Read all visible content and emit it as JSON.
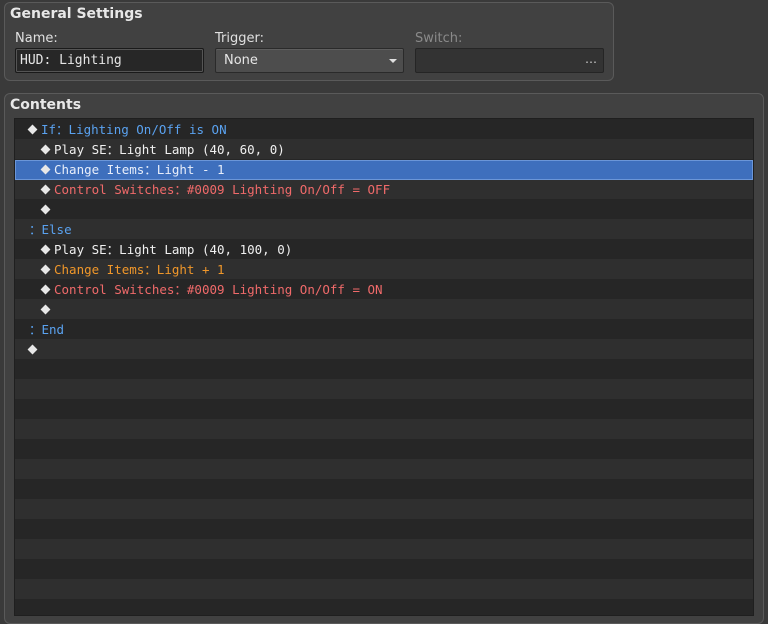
{
  "general": {
    "title": "General Settings",
    "name_label": "Name:",
    "name_value": "HUD: Lighting",
    "trigger_label": "Trigger:",
    "trigger_value": "None",
    "switch_label": "Switch:",
    "switch_button": "…"
  },
  "contents": {
    "title": "Contents",
    "rows": [
      {
        "indent": 0,
        "diamond": true,
        "text": "If：Lighting On/Off is ON",
        "color": "#5aa2f0"
      },
      {
        "indent": 1,
        "diamond": true,
        "text": "Play SE：Light Lamp (40, 60, 0)",
        "color": "#f0f0f0"
      },
      {
        "indent": 1,
        "diamond": true,
        "text": "Change Items：Light - 1",
        "color": "#f0972a",
        "selected": true
      },
      {
        "indent": 1,
        "diamond": true,
        "text": "Control Switches：#0009 Lighting On/Off = OFF",
        "color": "#f06a6a"
      },
      {
        "indent": 1,
        "diamond": true,
        "text": "",
        "color": "#f0f0f0"
      },
      {
        "indent": 0,
        "diamond": false,
        "text": "：Else",
        "color": "#5aa2f0"
      },
      {
        "indent": 1,
        "diamond": true,
        "text": "Play SE：Light Lamp (40, 100, 0)",
        "color": "#f0f0f0"
      },
      {
        "indent": 1,
        "diamond": true,
        "text": "Change Items：Light + 1",
        "color": "#f0972a"
      },
      {
        "indent": 1,
        "diamond": true,
        "text": "Control Switches：#0009 Lighting On/Off = ON",
        "color": "#f06a6a"
      },
      {
        "indent": 1,
        "diamond": true,
        "text": "",
        "color": "#f0f0f0"
      },
      {
        "indent": 0,
        "diamond": false,
        "text": "：End",
        "color": "#5aa2f0"
      },
      {
        "indent": 0,
        "diamond": true,
        "text": "",
        "color": "#f0f0f0"
      }
    ]
  }
}
